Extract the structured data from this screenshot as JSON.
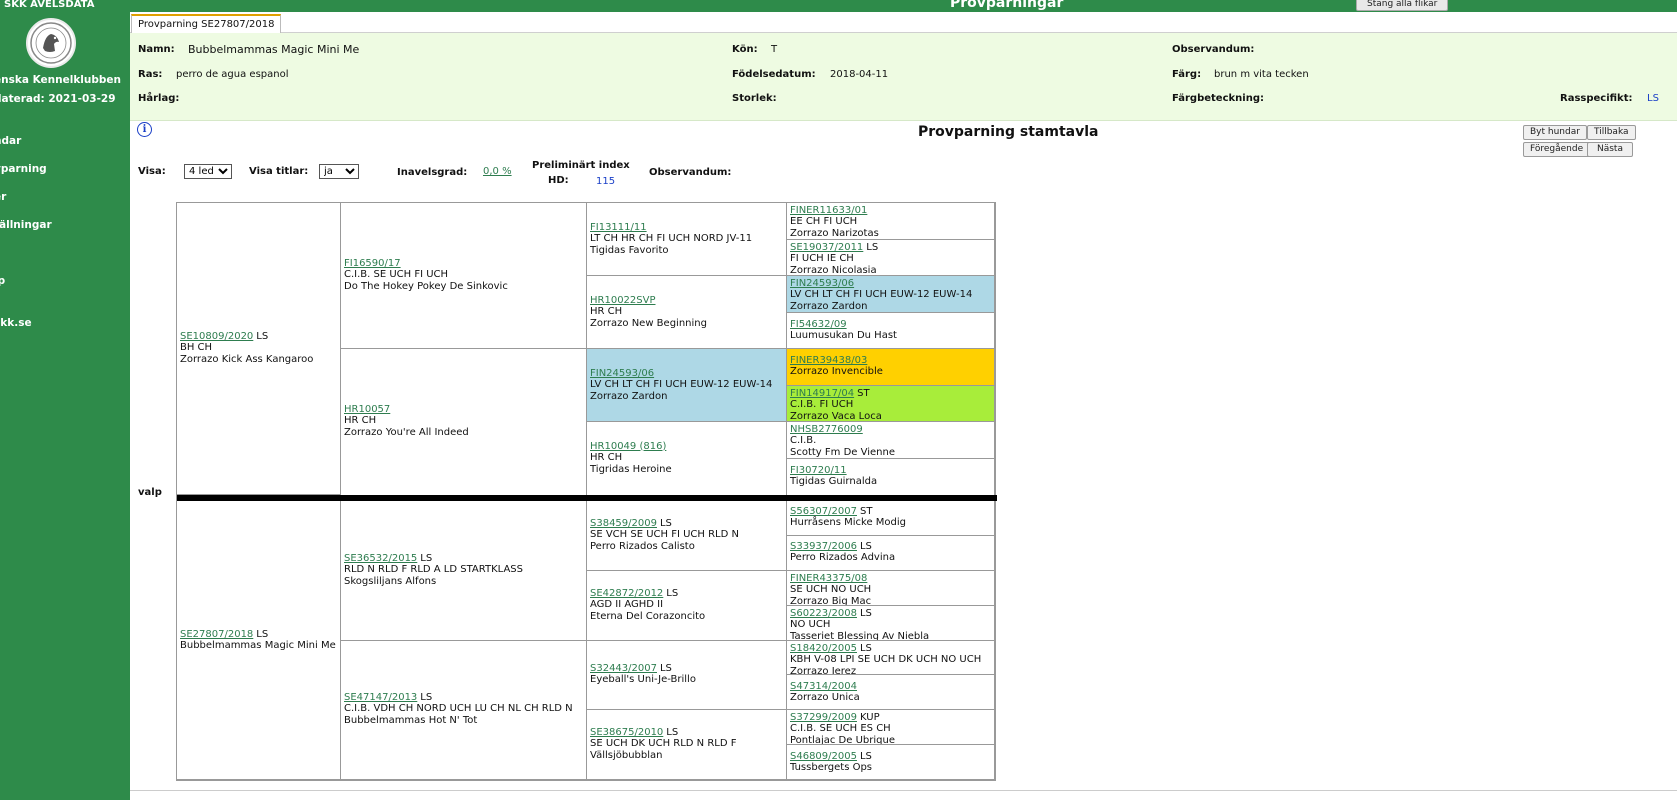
{
  "sidebar": {
    "title": "SKK AVELSDATA",
    "org": "enska Kennelklubben",
    "updated": "daterad: 2021-03-29",
    "items": [
      "ndar",
      "vparning",
      "er",
      "tällningar",
      "?",
      "lp",
      "skk.se"
    ]
  },
  "header": {
    "title": "Provparningar",
    "close_tabs": "Stäng alla flikar",
    "tab": "Provparning SE27807/2018"
  },
  "info": {
    "namn_label": "Namn:",
    "namn": "Bubbelmammas Magic Mini Me",
    "kon_label": "Kön:",
    "kon": "T",
    "observandum_label": "Observandum:",
    "ras_label": "Ras:",
    "ras": "perro de agua espanol",
    "fodelsedatum_label": "Födelsedatum:",
    "fodelsedatum": "2018-04-11",
    "farg_label": "Färg:",
    "farg": "brun m vita tecken",
    "harlag_label": "Hårlag:",
    "storlek_label": "Storlek:",
    "fargbeteckning_label": "Färgbeteckning:",
    "rasspecifikt_label": "Rasspecifikt:",
    "rasspecifikt": "LS"
  },
  "pedigree_header": {
    "info_icon": "i",
    "title": "Provparning stamtavla",
    "buttons": {
      "byt": "Byt hundar",
      "tillbaka": "Tillbaka",
      "foregaende": "Föregående",
      "nasta": "Nästa"
    },
    "visa_label": "Visa:",
    "visa_value": "4 led",
    "visa_titlar_label": "Visa titlar:",
    "visa_titlar_value": "ja",
    "inavelsgrad_label": "Inavelsgrad:",
    "inavelsgrad": "0,0 %",
    "index_label": "Preliminärt index",
    "hd_label": "HD:",
    "hd": "115",
    "observandum_label": "Observandum:",
    "valp_label": "valp"
  },
  "pedigree": {
    "gen1": [
      {
        "reg": "SE10809/2020",
        "badge": "LS",
        "titles": "BH CH",
        "name": "Zorrazo Kick Ass Kangaroo"
      },
      {
        "reg": "SE27807/2018",
        "badge": "LS",
        "titles": "",
        "name": "Bubbelmammas Magic Mini Me"
      }
    ],
    "gen2": [
      {
        "reg": "FI16590/17",
        "badge": "",
        "titles": "C.I.B. SE UCH FI UCH",
        "name": "Do The Hokey Pokey De Sinkovic"
      },
      {
        "reg": "HR10057",
        "badge": "",
        "titles": "HR CH",
        "name": "Zorrazo You're All Indeed"
      },
      {
        "reg": "SE36532/2015",
        "badge": "LS",
        "titles": "RLD N RLD F RLD A LD STARTKLASS",
        "name": "Skogsliljans Alfons"
      },
      {
        "reg": "SE47147/2013",
        "badge": "LS",
        "titles": "C.I.B. VDH CH NORD UCH LU CH NL CH RLD N",
        "name": "Bubbelmammas Hot N' Tot"
      }
    ],
    "gen3": [
      {
        "reg": "FI13111/11",
        "badge": "",
        "titles": "LT CH HR CH FI UCH NORD JV-11",
        "name": "Tigidas Favorito"
      },
      {
        "reg": "HR10022SVP",
        "badge": "",
        "titles": "HR CH",
        "name": "Zorrazo New Beginning"
      },
      {
        "reg": "FIN24593/06",
        "badge": "",
        "titles": "LV CH LT CH FI UCH EUW-12 EUW-14",
        "name": "Zorrazo Zardon"
      },
      {
        "reg": "HR10049 (816)",
        "badge": "",
        "titles": "HR CH",
        "name": "Tigridas Heroine"
      },
      {
        "reg": "S38459/2009",
        "badge": "LS",
        "titles": "SE VCH SE UCH FI UCH RLD N",
        "name": "Perro Rizados Calisto"
      },
      {
        "reg": "SE42872/2012",
        "badge": "LS",
        "titles": "AGD II AGHD II",
        "name": "Eterna Del Corazoncito"
      },
      {
        "reg": "S32443/2007",
        "badge": "LS",
        "titles": "",
        "name": "Eyeball's Uni-Je-Brillo"
      },
      {
        "reg": "SE38675/2010",
        "badge": "LS",
        "titles": "SE UCH DK UCH RLD N RLD F",
        "name": "Vällsjöbubblan"
      }
    ],
    "gen4": [
      {
        "reg": "FINER11633/01",
        "badge": "",
        "titles": "EE CH FI UCH",
        "name": "Zorrazo Narizotas"
      },
      {
        "reg": "SE19037/2011",
        "badge": "LS",
        "titles": "FI UCH IE CH",
        "name": "Zorrazo Nicolasia"
      },
      {
        "reg": "FIN24593/06",
        "badge": "",
        "titles": "LV CH LT CH FI UCH EUW-12 EUW-14",
        "name": "Zorrazo Zardon"
      },
      {
        "reg": "FI54632/09",
        "badge": "",
        "titles": "",
        "name": "Luumusukan Du Hast"
      },
      {
        "reg": "FINER39438/03",
        "badge": "",
        "titles": "",
        "name": "Zorrazo Invencible"
      },
      {
        "reg": "FIN14917/04",
        "badge": "ST",
        "titles": "C.I.B. FI UCH",
        "name": "Zorrazo Vaca Loca"
      },
      {
        "reg": "NHSB2776009",
        "badge": "",
        "titles": "C.I.B.",
        "name": "Scotty Fm De Vienne"
      },
      {
        "reg": "FI30720/11",
        "badge": "",
        "titles": "",
        "name": "Tigidas Guirnalda"
      },
      {
        "reg": "S56307/2007",
        "badge": "ST",
        "titles": "",
        "name": "Hurråsens Micke Modig"
      },
      {
        "reg": "S33937/2006",
        "badge": "LS",
        "titles": "",
        "name": "Perro Rizados Advina"
      },
      {
        "reg": "FINER43375/08",
        "badge": "",
        "titles": "SE UCH NO UCH",
        "name": "Zorrazo Big Mac"
      },
      {
        "reg": "S60223/2008",
        "badge": "LS",
        "titles": "NO UCH",
        "name": "Tasseriet Blessing Av Niebla"
      },
      {
        "reg": "S18420/2005",
        "badge": "LS",
        "titles": "KBH V-08 LPI SE UCH DK UCH NO UCH",
        "name": "Zorrazo Jerez"
      },
      {
        "reg": "S47314/2004",
        "badge": "",
        "titles": "",
        "name": "Zorrazo Unica"
      },
      {
        "reg": "S37299/2009",
        "badge": "KUP",
        "titles": "C.I.B. SE UCH ES CH",
        "name": "Pontlajac De Ubrique"
      },
      {
        "reg": "S46809/2005",
        "badge": "LS",
        "titles": "",
        "name": "Tussbergets Ops"
      }
    ],
    "highlight_colors": {
      "blue": "#aed8e6",
      "orange": "#ffd000",
      "green": "#a8ed3a"
    }
  }
}
